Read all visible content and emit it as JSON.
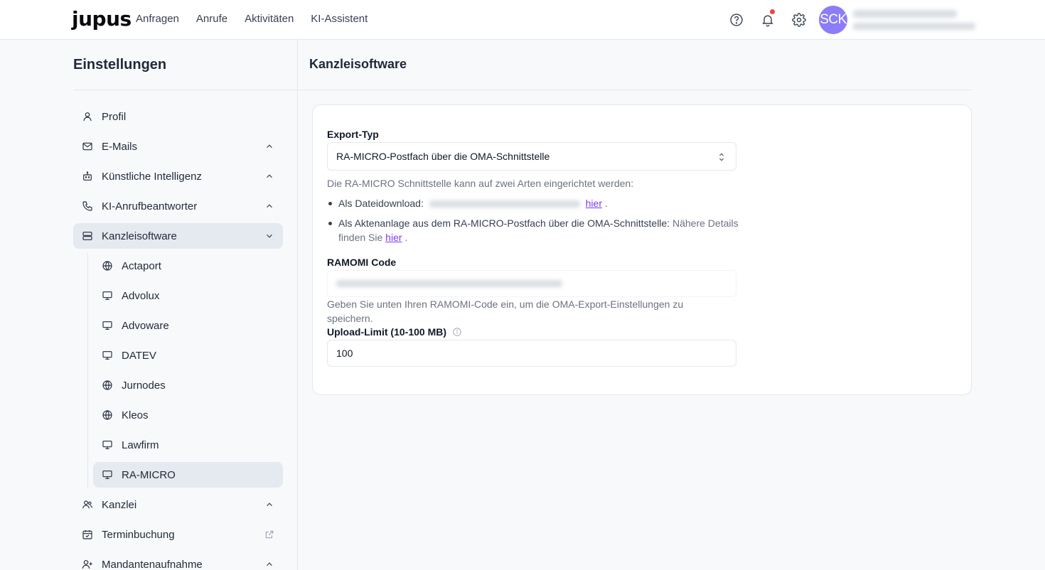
{
  "app": {
    "logo": "jupus"
  },
  "nav": [
    "Anfragen",
    "Anrufe",
    "Aktivitäten",
    "KI-Assistent"
  ],
  "header": {
    "avatar_initials": "SCK",
    "icons": [
      "help-circle-icon",
      "bell-icon",
      "gear-icon"
    ],
    "notification_dot_color": "#ef4444",
    "avatar_color": "#8b7cf8"
  },
  "sidebar": {
    "title": "Einstellungen",
    "items_top": [
      {
        "label": "Profil",
        "icon": "user-icon"
      },
      {
        "label": "E-Mails",
        "icon": "mail-icon",
        "chevron": "up"
      },
      {
        "label": "Künstliche Intelligenz",
        "icon": "robot-icon",
        "chevron": "up"
      },
      {
        "label": "KI-Anrufbeantworter",
        "icon": "phone-icon",
        "chevron": "up"
      },
      {
        "label": "Kanzleisoftware",
        "icon": "server-icon",
        "chevron": "down",
        "active": true
      }
    ],
    "sub_items": [
      {
        "label": "Actaport",
        "icon": "globe-icon"
      },
      {
        "label": "Advolux",
        "icon": "monitor-icon"
      },
      {
        "label": "Advoware",
        "icon": "monitor-icon"
      },
      {
        "label": "DATEV",
        "icon": "monitor-icon"
      },
      {
        "label": "Jurnodes",
        "icon": "globe-icon"
      },
      {
        "label": "Kleos",
        "icon": "globe-icon"
      },
      {
        "label": "Lawfirm",
        "icon": "monitor-icon"
      },
      {
        "label": "RA-MICRO",
        "icon": "monitor-icon",
        "active": true
      }
    ],
    "items_bottom": [
      {
        "label": "Kanzlei",
        "icon": "users-icon",
        "chevron": "up"
      },
      {
        "label": "Terminbuchung",
        "icon": "calendar-check-icon",
        "external": true
      },
      {
        "label": "Mandantenaufnahme",
        "icon": "user-plus-icon",
        "chevron": "up"
      }
    ]
  },
  "main": {
    "title": "Kanzleisoftware",
    "export_label": "Export-Typ",
    "export_value": "RA-MICRO-Postfach über die OMA-Schnittstelle",
    "intro": "Die RA-MICRO Schnittstelle kann auf zwei Arten eingerichtet werden:",
    "bullet1_label": "Als Dateidownload:",
    "bullet1_link": "hier",
    "bullet1_end": ".",
    "bullet2_label": "Als Aktenanlage aus dem RA-MICRO-Postfach über die OMA-Schnittstelle:",
    "bullet2_text": "Nähere Details finden Sie",
    "bullet2_link": "hier",
    "bullet2_end": ".",
    "ramomi_label": "RAMOMI Code",
    "ramomi_help": "Geben Sie unten Ihren RAMOMI-Code ein, um die OMA-Export-Einstellungen zu speichern.",
    "upload_label": "Upload-Limit (10-100 MB)",
    "upload_value": "100",
    "link_color": "#7c3aed"
  }
}
